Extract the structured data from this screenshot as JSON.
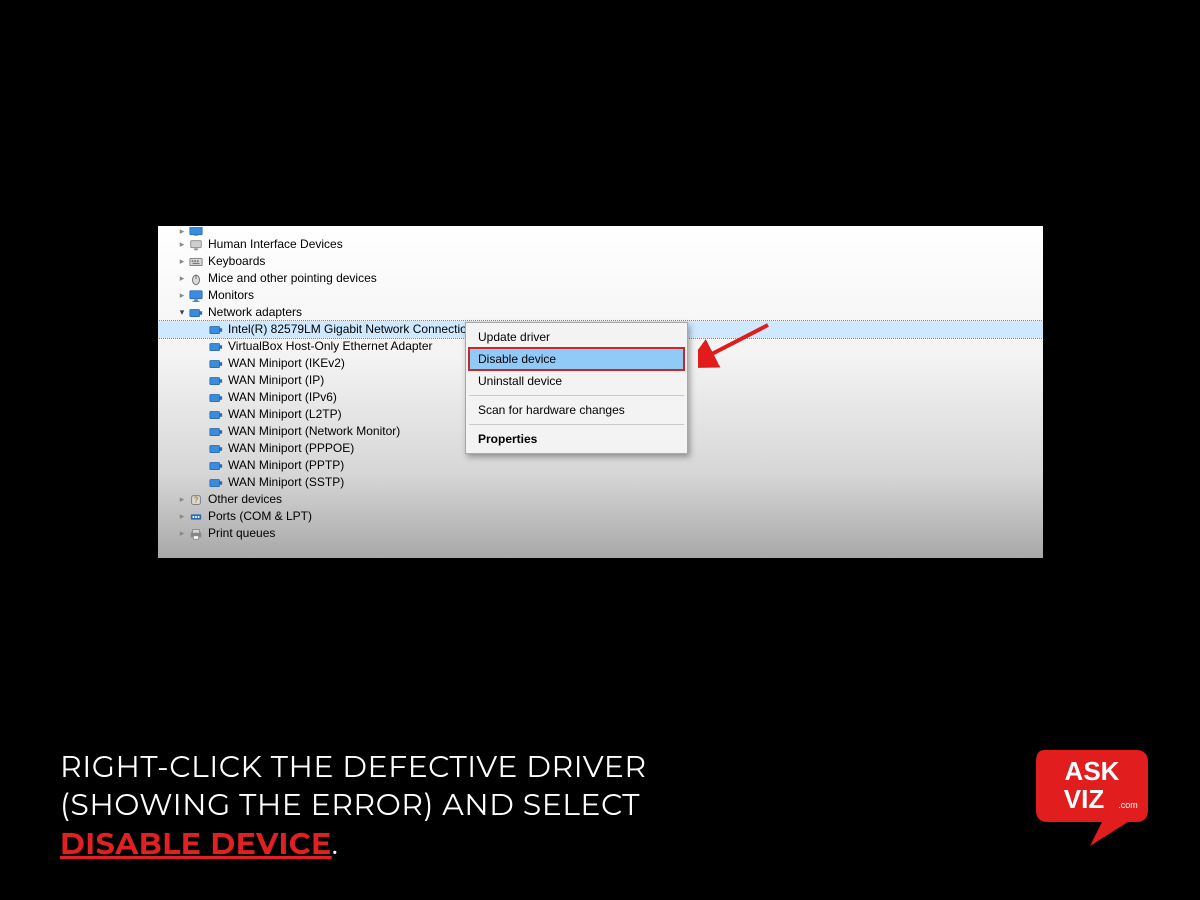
{
  "tree": {
    "categories": [
      {
        "label": "Human Interface Devices",
        "icon": "hid"
      },
      {
        "label": "Keyboards",
        "icon": "keyboard"
      },
      {
        "label": "Mice and other pointing devices",
        "icon": "mouse"
      },
      {
        "label": "Monitors",
        "icon": "monitor"
      }
    ],
    "network": {
      "label": "Network adapters",
      "children": [
        {
          "label": "Intel(R) 82579LM Gigabit Network Connection",
          "selected": true
        },
        {
          "label": "VirtualBox Host-Only Ethernet Adapter"
        },
        {
          "label": "WAN Miniport (IKEv2)"
        },
        {
          "label": "WAN Miniport (IP)"
        },
        {
          "label": "WAN Miniport (IPv6)"
        },
        {
          "label": "WAN Miniport (L2TP)"
        },
        {
          "label": "WAN Miniport (Network Monitor)"
        },
        {
          "label": "WAN Miniport (PPPOE)"
        },
        {
          "label": "WAN Miniport (PPTP)"
        },
        {
          "label": "WAN Miniport (SSTP)"
        }
      ]
    },
    "tail": [
      {
        "label": "Other devices",
        "icon": "other"
      },
      {
        "label": "Ports (COM & LPT)",
        "icon": "ports"
      },
      {
        "label": "Print queues",
        "icon": "printer"
      }
    ]
  },
  "context_menu": {
    "items": [
      {
        "label": "Update driver"
      },
      {
        "label": "Disable device",
        "highlight": true
      },
      {
        "label": "Uninstall device"
      },
      {
        "sep": true
      },
      {
        "label": "Scan for hardware changes"
      },
      {
        "sep": true
      },
      {
        "label": "Properties",
        "bold": true
      }
    ]
  },
  "caption": {
    "line1": "RIGHT-CLICK THE DEFECTIVE DRIVER",
    "line2": "(SHOWING THE ERROR) AND SELECT",
    "emphasis": "DISABLE DEVICE",
    "tail": "."
  },
  "logo": {
    "line1": "ASK",
    "line2": "VIZ",
    "dot": ".com"
  }
}
